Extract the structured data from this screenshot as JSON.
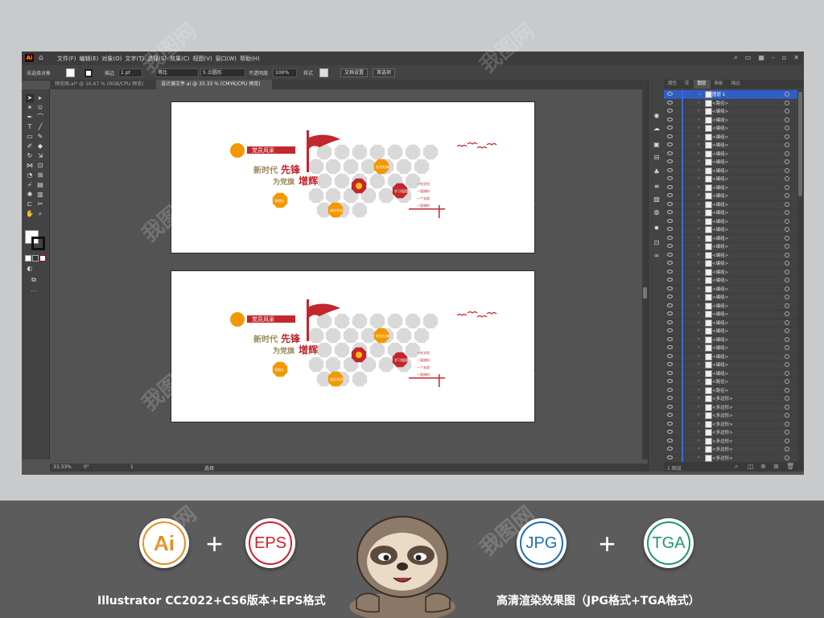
{
  "menubar": {
    "logo": "Ai",
    "items": [
      "文件(F)",
      "编辑(E)",
      "对象(O)",
      "文字(T)",
      "选择(S)",
      "效果(C)",
      "视图(V)",
      "窗口(W)",
      "帮助(H)"
    ]
  },
  "control_bar": {
    "selection_label": "未选择对象",
    "stroke_label": "描边",
    "stroke_width": "1 pt",
    "profile": "等比",
    "brush": "5 点圆形",
    "opacity_label": "不透明度",
    "opacity_value": "100%",
    "style_label": "样式",
    "doc_setup": "文档设置",
    "preferences": "首选项"
  },
  "document_tabs": [
    {
      "label": "预览图.ai* @ 16.67 % (RGB/CPU 预览)",
      "active": false
    },
    {
      "label": "设计源文件.ai @ 33.33 % (CMYK/CPU 预览)",
      "active": true
    }
  ],
  "artwork": {
    "title": "党员风采",
    "line1_a": "新时代",
    "line1_b": "先锋",
    "line2_a": "为党旗",
    "line2_b": "增辉",
    "badges": [
      "亮相台",
      "创先争优",
      "党员先锋",
      "学习强国"
    ],
    "list": [
      "一先学信",
      "一面旗帜",
      "一个支部",
      "一面旗帜"
    ]
  },
  "status_bar": {
    "zoom": "33.33%",
    "rotation": "0°",
    "page": "1",
    "mode": "选择"
  },
  "layers_panel": {
    "tabs": [
      "属性",
      "库",
      "图层",
      "画板",
      "描边"
    ],
    "active_tab": "图层",
    "top_layer": "图层 1",
    "rows": [
      "<路径>",
      "<编组>",
      "<编组>",
      "<编组>",
      "<编组>",
      "<编组>",
      "<编组>",
      "<编组>",
      "<编组>",
      "<编组>",
      "<编组>",
      "<编组>",
      "<编组>",
      "<编组>",
      "<编组>",
      "<编组>",
      "<编组>",
      "<编组>",
      "<编组>",
      "<编组>",
      "<编组>",
      "<编组>",
      "<编组>",
      "<编组>",
      "<编组>",
      "<编组>",
      "<编组>",
      "<编组>",
      "<编组>",
      "<编组>",
      "<编组>",
      "<编组>",
      "<编组>",
      "<路径>",
      "<路径>",
      "<多边形>",
      "<多边形>",
      "<多边形>",
      "<多边形>",
      "<多边形>",
      "<多边形>",
      "<多边形>",
      "<多边形>"
    ],
    "footer": "1 图层"
  },
  "formats": {
    "ai": "Ai",
    "eps": "EPS",
    "jpg": "JPG",
    "tga": "TGA",
    "plus": "+",
    "caption_left": "Illustrator CC2022+CS6版本+EPS格式",
    "caption_right": "高清渲染效果图（JPG格式+TGA格式）"
  },
  "watermark": "我图网",
  "colors": {
    "red": "#c1272d",
    "orange": "#f39800",
    "grey_hex": "#d9d9d9",
    "ai_text": "#e8891a",
    "eps_text": "#d21f2d",
    "jpg_text": "#1e6fb5",
    "tga_text": "#1d9a6c"
  }
}
